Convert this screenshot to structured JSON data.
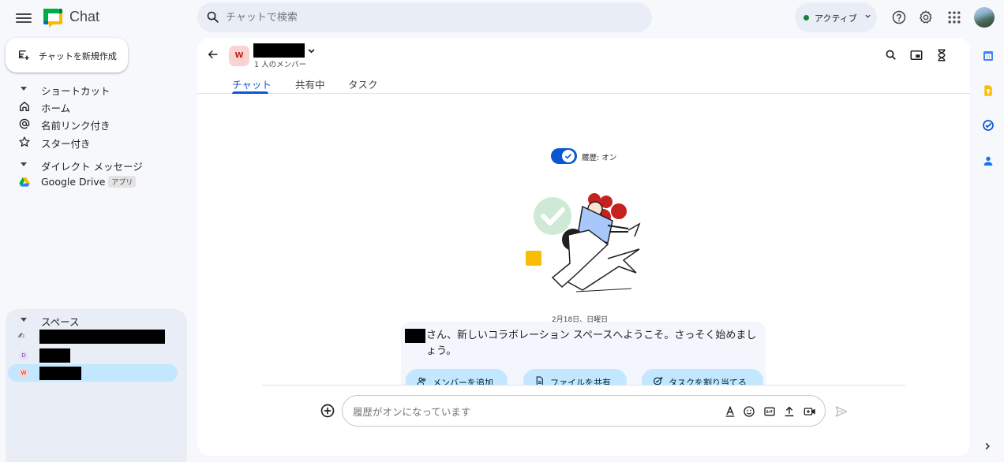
{
  "app": {
    "title": "Chat",
    "menu_icon": "hamburger-icon",
    "logo_icon": "google-chat-logo"
  },
  "search": {
    "placeholder": "チャットで検索"
  },
  "status": {
    "label": "アクティブ",
    "color": "#188038"
  },
  "topbar_icons": [
    "help-icon",
    "settings-gear-icon",
    "apps-grid-icon",
    "account-avatar"
  ],
  "sidebar": {
    "new_chat_label": "チャットを新規作成",
    "shortcuts_header": "ショートカット",
    "shortcuts": [
      {
        "label": "ホーム",
        "icon": "home-icon"
      },
      {
        "label": "名前リンク付き",
        "icon": "at-sign-icon"
      },
      {
        "label": "スター付き",
        "icon": "star-icon"
      }
    ],
    "dm_header": "ダイレクト メッセージ",
    "dms": [
      {
        "label": "Google Drive",
        "badge": "アプリ",
        "icon": "google-drive-icon"
      }
    ],
    "spaces_header": "スペース",
    "spaces": [
      {
        "avatar": "✍",
        "name_redacted": true,
        "selected": false
      },
      {
        "avatar": "D",
        "name_redacted": true,
        "selected": false
      },
      {
        "avatar": "W",
        "name_redacted": true,
        "selected": true
      }
    ]
  },
  "conversation": {
    "space_avatar": "W",
    "member_count": "1 人のメンバー",
    "tabs": [
      {
        "label": "チャット",
        "active": true
      },
      {
        "label": "共有中",
        "active": false
      },
      {
        "label": "タスク",
        "active": false
      }
    ],
    "header_icons": [
      "search-icon",
      "picture-in-picture-icon",
      "hourglass-icon"
    ],
    "history_label": "履歴: オン",
    "history_on": true,
    "date_label": "2月18日、日曜日",
    "welcome_text": "さん、新しいコラボレーション スペースへようこそ。さっそく始めましょう。",
    "actions": [
      {
        "label": "メンバーを追加",
        "icon": "add-people-icon"
      },
      {
        "label": "ファイルを共有",
        "icon": "file-icon"
      },
      {
        "label": "タスクを割り当てる",
        "icon": "task-add-icon"
      }
    ],
    "composer_placeholder": "履歴がオンになっています",
    "composer_icons": [
      "format-text-icon",
      "emoji-icon",
      "gif-icon",
      "upload-icon",
      "video-meet-icon"
    ]
  },
  "colors": {
    "accent": "#0b57d0",
    "selected": "#c2e7ff",
    "background": "#f6f8fc"
  },
  "rail_icons": [
    "calendar-icon",
    "keep-icon",
    "tasks-icon",
    "contacts-icon"
  ]
}
